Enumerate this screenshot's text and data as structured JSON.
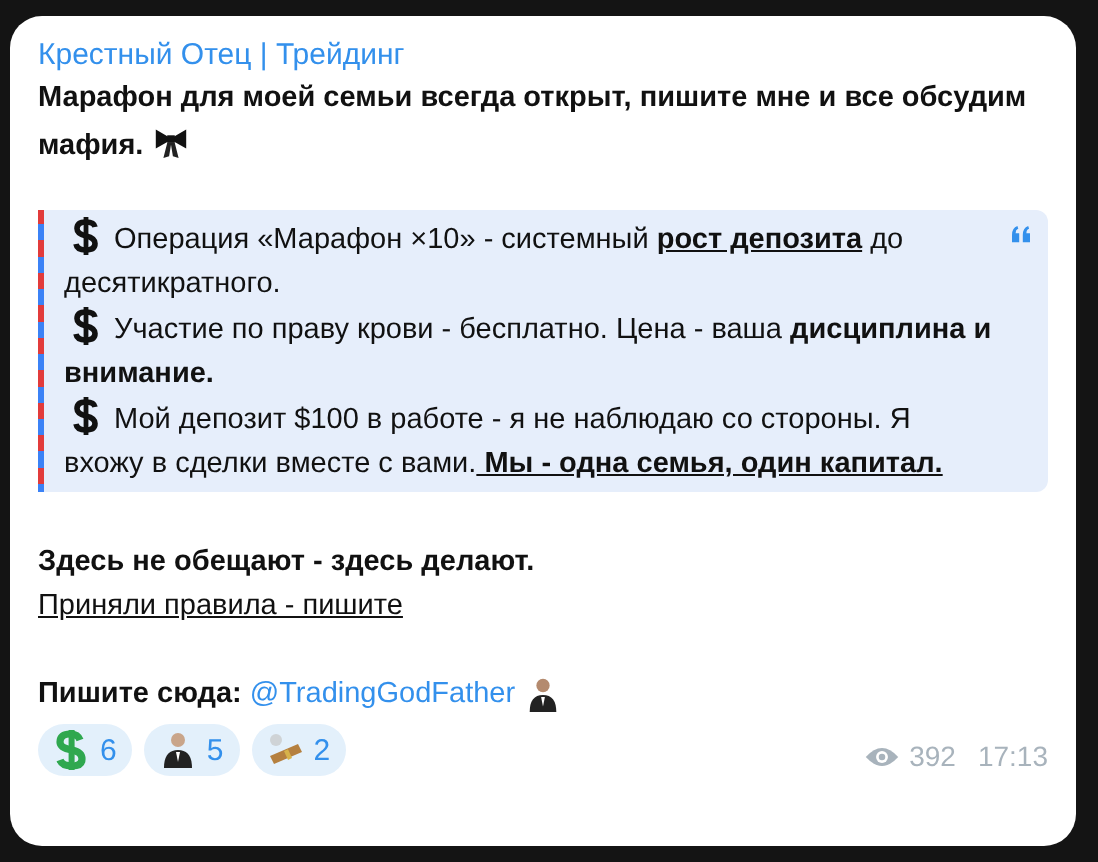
{
  "channel": {
    "name": "Крестный Отец | Трейдинг"
  },
  "message": {
    "intro": "Марафон для моей семьи всегда открыт, пишите мне и все обсудим мафия.",
    "quote": [
      {
        "segments": [
          {
            "kind": "text",
            "text": "Операция «Марафон ×10» - системный "
          },
          {
            "kind": "underlined",
            "text": "рост депозита"
          },
          {
            "kind": "text",
            "text": " до десятикратного."
          }
        ]
      },
      {
        "segments": [
          {
            "kind": "text",
            "text": "Участие по праву крови - бесплатно. Цена - ваша "
          },
          {
            "kind": "strong",
            "text": "дисциплина и внимание."
          }
        ]
      },
      {
        "segments": [
          {
            "kind": "text",
            "text": "Мой депозит $100 в работе - я не наблюдаю со стороны. Я вхожу в сделки вместе с вами."
          },
          {
            "kind": "underlined",
            "text": " Мы - одна семья, один капитал."
          }
        ]
      }
    ],
    "slogan": "Здесь не обещают - здесь делают.",
    "rules_link": "Приняли правила - пишите",
    "contact_label": "Пишите сюда:",
    "contact_link": "@TradingGodFather"
  },
  "reactions": [
    {
      "kind": "dollar",
      "count": "6"
    },
    {
      "kind": "figure",
      "count": "5"
    },
    {
      "kind": "cigar",
      "count": "2"
    }
  ],
  "footer": {
    "views": "392",
    "time": "17:13"
  }
}
